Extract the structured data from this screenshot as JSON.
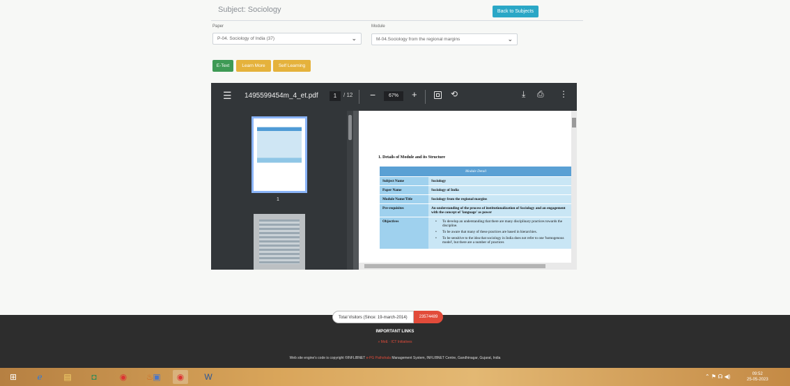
{
  "header": {
    "subject_title": "Subject: Sociology",
    "back_button": "Back to Subjects"
  },
  "filters": {
    "paper_label": "Paper",
    "paper_value": "P-04. Sociology of India (37)",
    "module_label": "Module",
    "module_value": "M-04.Sociology from the regional margins"
  },
  "tabs": {
    "etext": "E-Text",
    "learn_more": "Learn More",
    "self_learning": "Self Learning"
  },
  "viewer": {
    "file_name": "1495599454m_4_et.pdf",
    "current_page": "1",
    "total_pages": "/ 12",
    "zoom": "67%",
    "thumbnail_number": "1"
  },
  "document": {
    "heading": "1.   Details of Module and its Structure",
    "table_header": "Module Detail",
    "rows": [
      {
        "key": "Subject Name",
        "value": "Sociology"
      },
      {
        "key": "Paper Name",
        "value": "Sociology of India"
      },
      {
        "key": "Module Name/Title",
        "value": "Sociology from the regional margins"
      },
      {
        "key": "Pre-requisites",
        "value": "An understanding of the process of institutionalization of Sociology and an engagement with the concept of 'language' as power"
      }
    ],
    "objectives_key": "Objectives",
    "objectives": [
      "To develop an understanding that there are many disciplinary practices towards the discipline.",
      "To be aware that many of these practices are based in hierarchies.",
      "To be sensitive to the idea that sociology in India does not refer to one 'homogenous model', but there are a number of practices"
    ]
  },
  "footer": {
    "visitors_label": "Total Visitors (Since: 19-march-2014)",
    "visitors_count": "23574489",
    "important_links": "IMPORTANT LINKS",
    "links_sub": "» MoE  ·  ICT Initiatives",
    "copyright_pre": "Web site engine's code is copyright ©INFLIBNET",
    "copyright_hl": "e-PG Pathshala",
    "copyright_post": "Management System, INFLIBNET Centre, Gandhinagar, Gujarat, India"
  },
  "taskbar": {
    "clock_time": "09:52",
    "clock_date": "25-05-2023"
  },
  "colors": {
    "accent": "#2aa7c6",
    "etext": "#3e9a55",
    "learn": "#e5b23c",
    "counter": "#e24b3a"
  }
}
